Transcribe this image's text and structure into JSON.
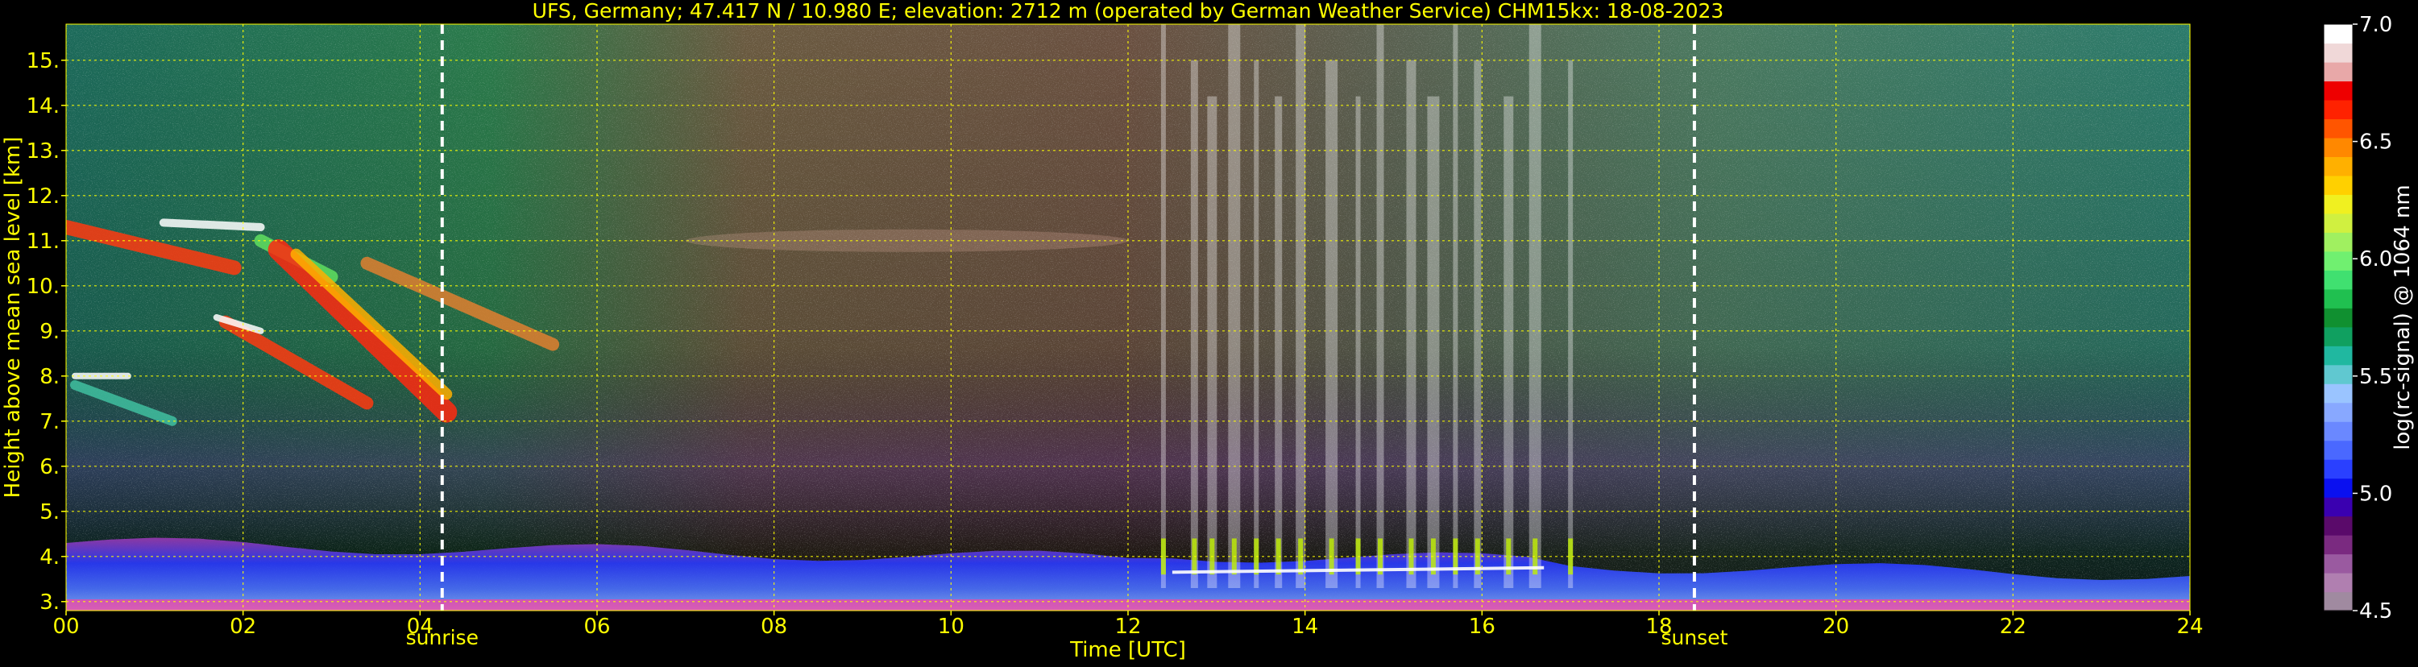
{
  "chart_data": {
    "type": "heatmap",
    "title": "UFS, Germany; 47.417 N / 10.980 E; elevation: 2712 m  (operated by German Weather Service)    CHM15kx: 18-08-2023",
    "xlabel": "Time [UTC]",
    "ylabel": "Height above mean sea level [km]",
    "xlim": [
      0,
      24
    ],
    "ylim": [
      2.8,
      15.8
    ],
    "xticks": [
      "00",
      "02",
      "04",
      "06",
      "08",
      "10",
      "12",
      "14",
      "16",
      "18",
      "20",
      "22",
      "24"
    ],
    "xtick_values": [
      0,
      2,
      4,
      6,
      8,
      10,
      12,
      14,
      16,
      18,
      20,
      22,
      24
    ],
    "yticks": [
      "3.",
      "4.",
      "5.",
      "6.",
      "7.",
      "8.",
      "9.",
      "10.",
      "11.",
      "12.",
      "13.",
      "14.",
      "15."
    ],
    "ytick_values": [
      3,
      4,
      5,
      6,
      7,
      8,
      9,
      10,
      11,
      12,
      13,
      14,
      15
    ],
    "grid": true,
    "grid_color": "#ffff00",
    "text_color": "#ffff00",
    "background": "#000000",
    "markers": [
      {
        "label": "sunrise",
        "x": 4.25
      },
      {
        "label": "sunset",
        "x": 18.4
      }
    ],
    "colorbar": {
      "label": "log(rc-signal) @ 1064 nm",
      "min": 4.5,
      "max": 7.0,
      "ticks": [
        "4.5",
        "5.0",
        "5.5",
        "6.0",
        "6.5",
        "7.0"
      ],
      "tick_values": [
        4.5,
        5.0,
        5.5,
        6.0,
        6.5,
        7.0
      ],
      "colors": [
        "#a08aa0",
        "#b07fb0",
        "#9a5aa0",
        "#7a2a80",
        "#5a0a6a",
        "#3a00b0",
        "#0a10f0",
        "#2a40ff",
        "#4a68ff",
        "#6a88ff",
        "#88a8ff",
        "#9ac4ff",
        "#60c8d0",
        "#20b8a0",
        "#10a060",
        "#109030",
        "#20c050",
        "#40e070",
        "#70f070",
        "#a0f060",
        "#d0f040",
        "#f0f020",
        "#ffd000",
        "#ffb000",
        "#ff8800",
        "#ff5500",
        "#ff2200",
        "#ee0000",
        "#e8a8a8",
        "#f0d8d8",
        "#ffffff"
      ]
    },
    "layers": [
      {
        "name": "boundary layer",
        "x_range": [
          0,
          24
        ],
        "height_top_km": [
          4.3,
          3.6
        ]
      },
      {
        "name": "cirrus",
        "x_range": [
          0,
          5.5
        ],
        "height_range_km": [
          7.0,
          11.5
        ]
      },
      {
        "name": "convective cloud columns",
        "x_range": [
          12.4,
          17.2
        ],
        "height_range_km": [
          3.3,
          15.8
        ]
      }
    ]
  }
}
